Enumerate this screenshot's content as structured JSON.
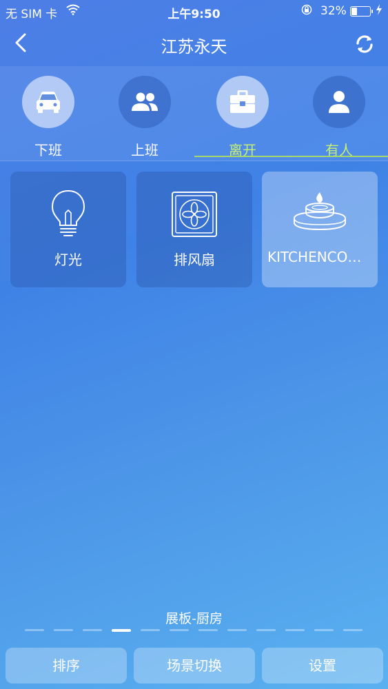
{
  "status_bar": {
    "carrier": "无 SIM 卡",
    "time": "上午9:50",
    "battery": "32%",
    "battery_level": 0.32
  },
  "nav": {
    "title": "江苏永天",
    "back_icon": "chevron-left-icon",
    "refresh_icon": "refresh-icon"
  },
  "scenes": [
    {
      "label": "下班",
      "icon": "car-icon",
      "active": false
    },
    {
      "label": "上班",
      "icon": "users-icon",
      "active": false
    },
    {
      "label": "离开",
      "icon": "briefcase-icon",
      "active": true
    },
    {
      "label": "有人",
      "icon": "person-icon",
      "active": false
    }
  ],
  "devices": [
    {
      "label": "灯光",
      "icon": "light-bulb-icon"
    },
    {
      "label": "排风扇",
      "icon": "exhaust-fan-icon"
    },
    {
      "label": "KITCHENCOOKER",
      "icon": "gas-stove-icon"
    }
  ],
  "panel": {
    "name": "展板-厨房",
    "page_count": 12,
    "current_page": 4
  },
  "bottom_bar": {
    "sort": "排序",
    "scene_switch": "场景切换",
    "settings": "设置"
  },
  "colors": {
    "active_scene": "#c6ef72",
    "underline": "#a9d86a"
  }
}
